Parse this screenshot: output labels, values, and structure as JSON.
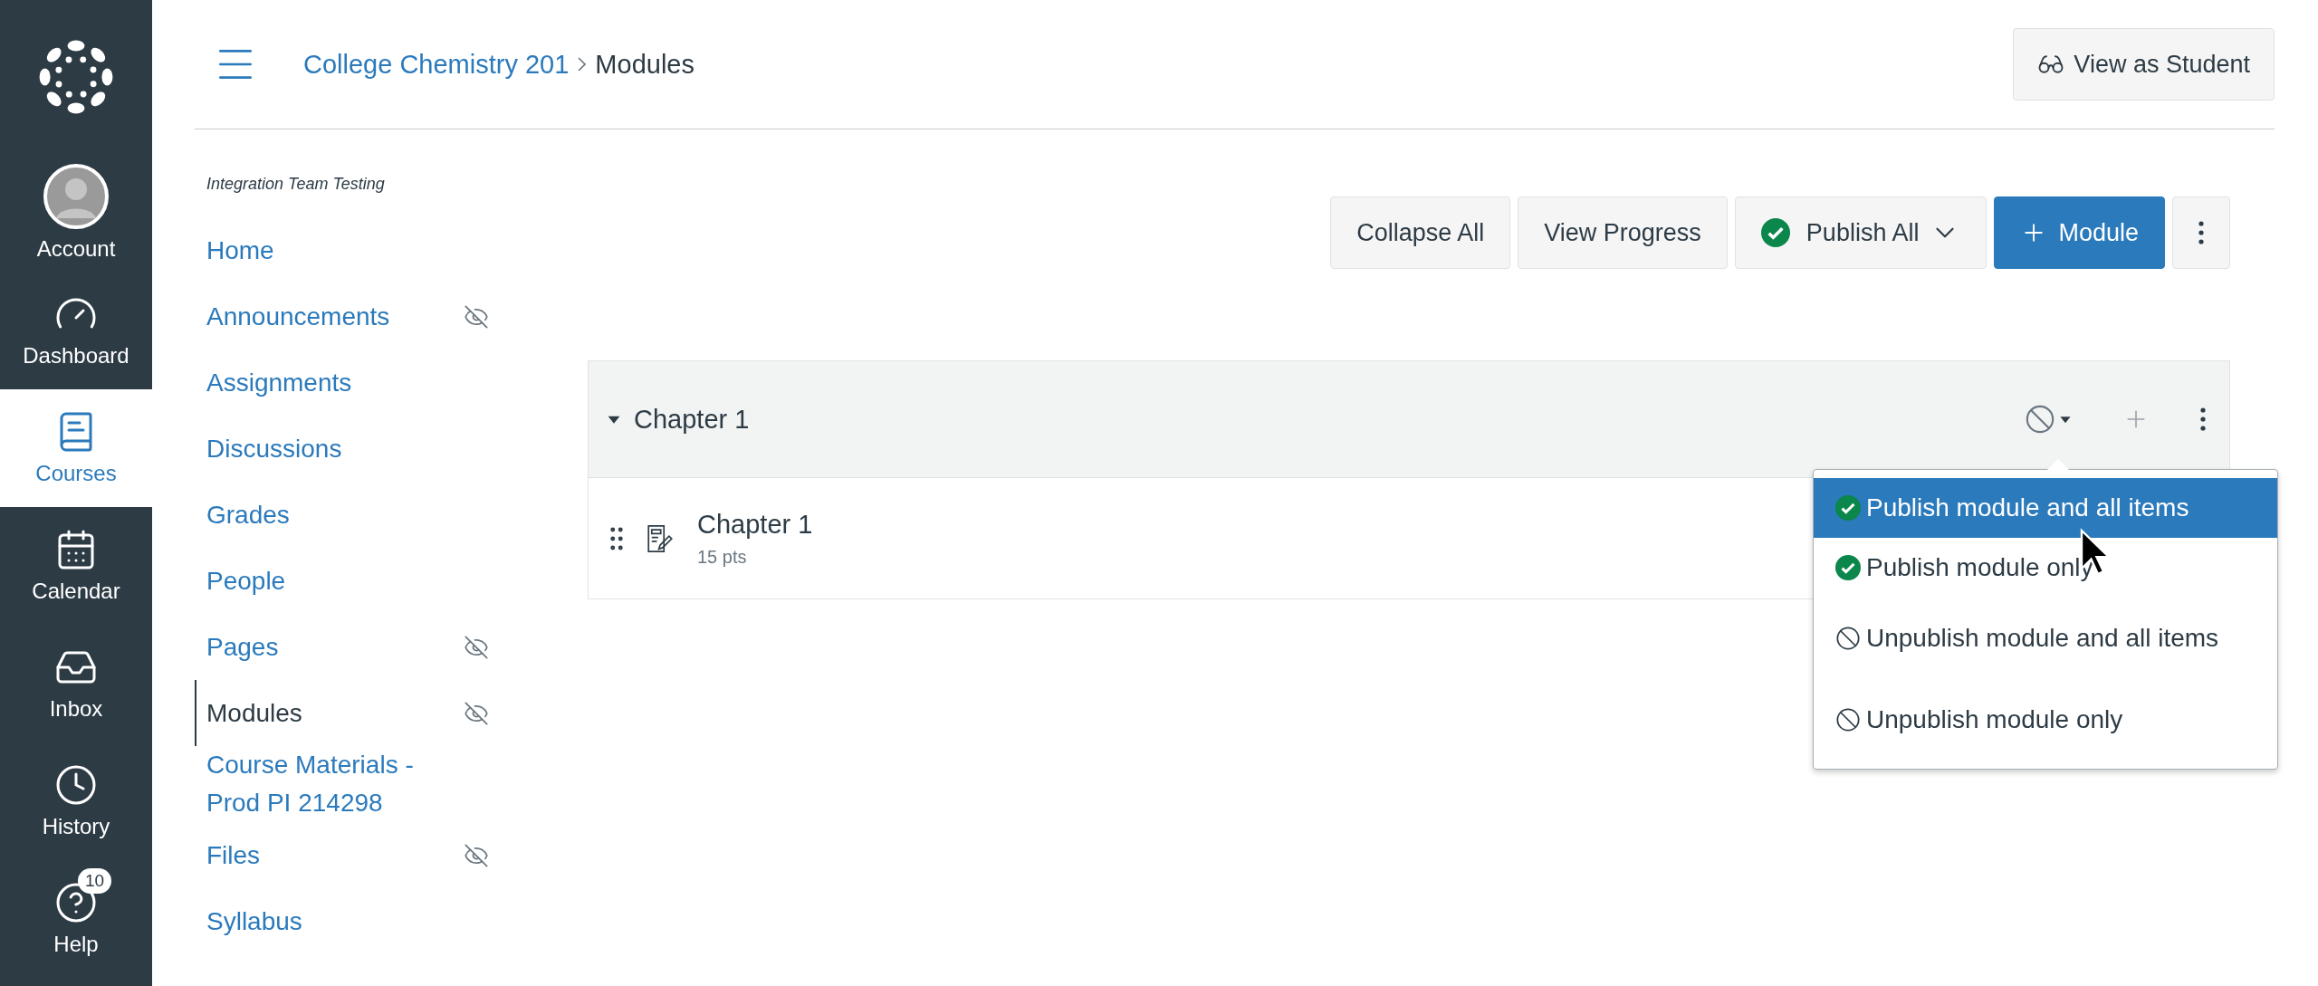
{
  "global_nav": {
    "items": [
      {
        "label": "Account",
        "selected": false
      },
      {
        "label": "Dashboard",
        "selected": false
      },
      {
        "label": "Courses",
        "selected": true
      },
      {
        "label": "Calendar",
        "selected": false
      },
      {
        "label": "Inbox",
        "selected": false
      },
      {
        "label": "History",
        "selected": false
      },
      {
        "label": "Help",
        "selected": false,
        "badge": "10"
      }
    ]
  },
  "header": {
    "breadcrumb": [
      "College Chemistry 201",
      "Modules"
    ],
    "view_as_student": "View as Student"
  },
  "course_nav": {
    "subtitle": "Integration Team Testing",
    "items": [
      {
        "label": "Home",
        "selected": false,
        "hidden": false
      },
      {
        "label": "Announcements",
        "selected": false,
        "hidden": true
      },
      {
        "label": "Assignments",
        "selected": false,
        "hidden": false
      },
      {
        "label": "Discussions",
        "selected": false,
        "hidden": false
      },
      {
        "label": "Grades",
        "selected": false,
        "hidden": false
      },
      {
        "label": "People",
        "selected": false,
        "hidden": false
      },
      {
        "label": "Pages",
        "selected": false,
        "hidden": true
      },
      {
        "label": "Modules",
        "selected": true,
        "hidden": true
      },
      {
        "label": "Course Materials - Prod PI 214298",
        "selected": false,
        "hidden": false
      },
      {
        "label": "Files",
        "selected": false,
        "hidden": true
      },
      {
        "label": "Syllabus",
        "selected": false,
        "hidden": false
      }
    ]
  },
  "toolbar": {
    "buttons": [
      {
        "label": "Collapse All",
        "kind": "plain"
      },
      {
        "label": "View Progress",
        "kind": "plain"
      },
      {
        "label": "Publish All",
        "kind": "publish"
      },
      {
        "label": "Module",
        "kind": "primary"
      }
    ]
  },
  "module": {
    "title": "Chapter 1",
    "expanded": true,
    "published": false,
    "items": [
      {
        "title": "Chapter 1",
        "points": "15 pts"
      }
    ],
    "publish_menu": [
      {
        "label": "Publish module and all items",
        "kind": "publish",
        "selected": true
      },
      {
        "label": "Publish module only",
        "kind": "publish",
        "selected": false
      },
      {
        "label": "Unpublish module and all items",
        "kind": "unpublish",
        "selected": false
      },
      {
        "label": "Unpublish module only",
        "kind": "unpublish",
        "selected": false
      }
    ]
  }
}
